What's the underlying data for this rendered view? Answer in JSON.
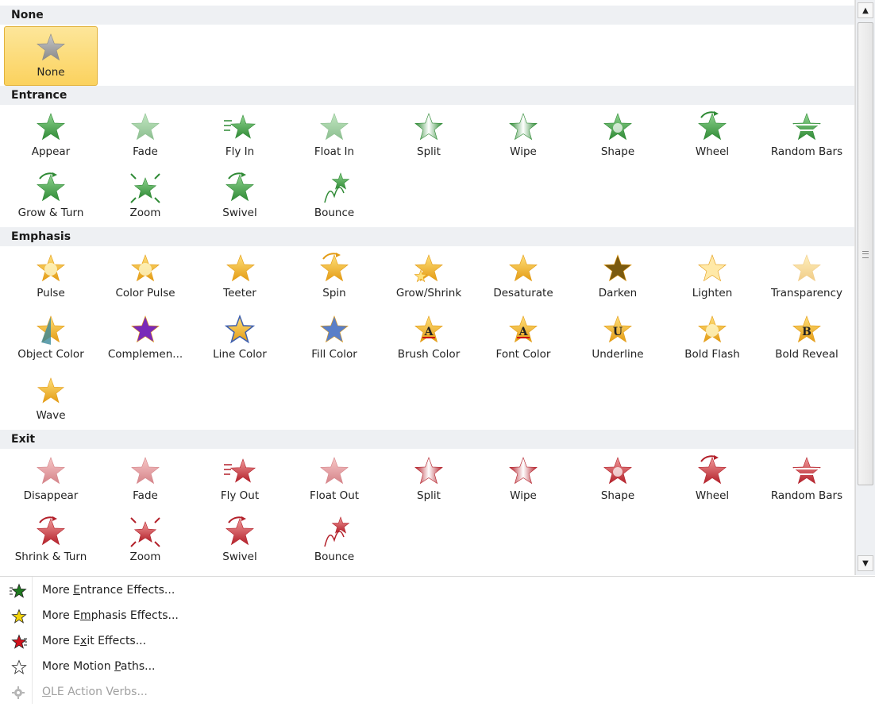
{
  "sections": [
    {
      "key": "none",
      "title": "None",
      "color": "gray",
      "rows": [
        [
          {
            "label": "None",
            "icon": "star-none-icon",
            "selected": true
          }
        ]
      ]
    },
    {
      "key": "entrance",
      "title": "Entrance",
      "color": "green",
      "rows": [
        [
          {
            "label": "Appear",
            "icon": "appear-star-icon"
          },
          {
            "label": "Fade",
            "icon": "fade-star-icon"
          },
          {
            "label": "Fly In",
            "icon": "fly-in-star-icon"
          },
          {
            "label": "Float In",
            "icon": "float-in-star-icon"
          },
          {
            "label": "Split",
            "icon": "split-star-icon"
          },
          {
            "label": "Wipe",
            "icon": "wipe-star-icon"
          },
          {
            "label": "Shape",
            "icon": "shape-star-icon"
          },
          {
            "label": "Wheel",
            "icon": "wheel-star-icon"
          },
          {
            "label": "Random Bars",
            "icon": "random-bars-star-icon"
          }
        ],
        [
          {
            "label": "Grow & Turn",
            "icon": "grow-turn-star-icon"
          },
          {
            "label": "Zoom",
            "icon": "zoom-star-icon"
          },
          {
            "label": "Swivel",
            "icon": "swivel-star-icon"
          },
          {
            "label": "Bounce",
            "icon": "bounce-star-icon"
          }
        ]
      ]
    },
    {
      "key": "emphasis",
      "title": "Emphasis",
      "color": "gold",
      "rows": [
        [
          {
            "label": "Pulse",
            "icon": "pulse-star-icon"
          },
          {
            "label": "Color Pulse",
            "icon": "color-pulse-star-icon"
          },
          {
            "label": "Teeter",
            "icon": "teeter-star-icon"
          },
          {
            "label": "Spin",
            "icon": "spin-star-icon"
          },
          {
            "label": "Grow/Shrink",
            "icon": "grow-shrink-star-icon"
          },
          {
            "label": "Desaturate",
            "icon": "desaturate-star-icon"
          },
          {
            "label": "Darken",
            "icon": "darken-star-icon"
          },
          {
            "label": "Lighten",
            "icon": "lighten-star-icon"
          },
          {
            "label": "Transparency",
            "icon": "transparency-star-icon"
          }
        ],
        [
          {
            "label": "Object Color",
            "icon": "object-color-star-icon"
          },
          {
            "label": "Complemen...",
            "icon": "complementary-star-icon"
          },
          {
            "label": "Line Color",
            "icon": "line-color-star-icon"
          },
          {
            "label": "Fill Color",
            "icon": "fill-color-star-icon"
          },
          {
            "label": "Brush Color",
            "icon": "brush-color-star-icon"
          },
          {
            "label": "Font Color",
            "icon": "font-color-star-icon"
          },
          {
            "label": "Underline",
            "icon": "underline-star-icon"
          },
          {
            "label": "Bold Flash",
            "icon": "bold-flash-star-icon"
          },
          {
            "label": "Bold Reveal",
            "icon": "bold-reveal-star-icon"
          }
        ],
        [
          {
            "label": "Wave",
            "icon": "wave-star-icon"
          }
        ]
      ]
    },
    {
      "key": "exit",
      "title": "Exit",
      "color": "red",
      "rows": [
        [
          {
            "label": "Disappear",
            "icon": "disappear-star-icon"
          },
          {
            "label": "Fade",
            "icon": "fade-star-icon"
          },
          {
            "label": "Fly Out",
            "icon": "fly-out-star-icon"
          },
          {
            "label": "Float Out",
            "icon": "float-out-star-icon"
          },
          {
            "label": "Split",
            "icon": "split-star-icon"
          },
          {
            "label": "Wipe",
            "icon": "wipe-star-icon"
          },
          {
            "label": "Shape",
            "icon": "shape-star-icon"
          },
          {
            "label": "Wheel",
            "icon": "wheel-star-icon"
          },
          {
            "label": "Random Bars",
            "icon": "random-bars-star-icon"
          }
        ],
        [
          {
            "label": "Shrink & Turn",
            "icon": "shrink-turn-star-icon"
          },
          {
            "label": "Zoom",
            "icon": "zoom-star-icon"
          },
          {
            "label": "Swivel",
            "icon": "swivel-star-icon"
          },
          {
            "label": "Bounce",
            "icon": "bounce-star-icon"
          }
        ]
      ]
    }
  ],
  "colors": {
    "gray": [
      "#8a8a8a",
      "#c7c7c7"
    ],
    "green": [
      "#2f8a35",
      "#8fd48f"
    ],
    "gold": [
      "#e39b14",
      "#ffe07a"
    ],
    "red": [
      "#b3202a",
      "#f19a9a"
    ],
    "selected_bg": "#fbd25e",
    "header_bg": "#eef0f3"
  },
  "scrollbar": {
    "up_icon": "scroll-up-arrow-icon",
    "down_icon": "scroll-down-arrow-icon",
    "up_glyph": "▲",
    "down_glyph": "▼"
  },
  "menu": [
    {
      "label": "More Entrance Effects...",
      "accel": "E",
      "icon": "green-star-icon",
      "color": "#1f7a1f",
      "enabled": true
    },
    {
      "label": "More Emphasis Effects...",
      "accel": "m",
      "icon": "yellow-star-icon",
      "color": "#f4d40c",
      "enabled": true
    },
    {
      "label": "More Exit Effects...",
      "accel": "x",
      "icon": "red-star-icon",
      "color": "#d1121c",
      "enabled": true
    },
    {
      "label": "More Motion Paths...",
      "accel": "P",
      "icon": "outline-star-icon",
      "color": "#ffffff",
      "enabled": true
    },
    {
      "label": "OLE Action Verbs...",
      "accel": "O",
      "icon": "gear-icon",
      "color": "#b5b5b5",
      "enabled": false
    }
  ]
}
